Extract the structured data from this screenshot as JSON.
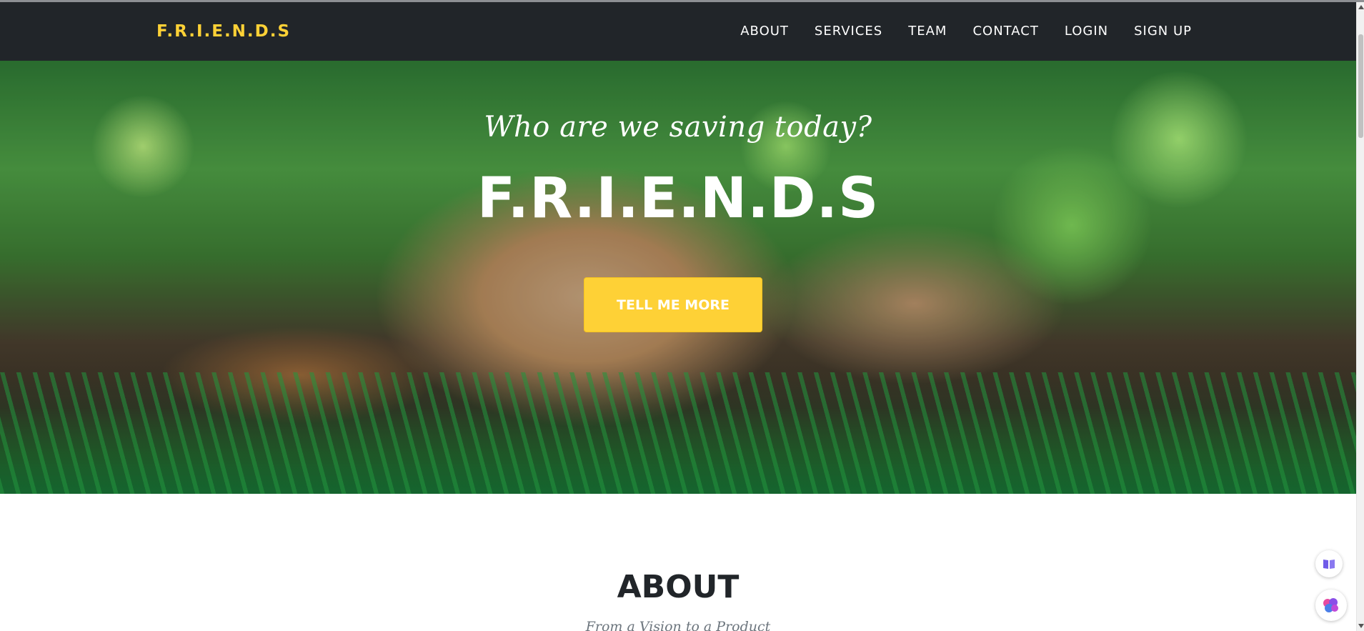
{
  "navbar": {
    "brand": "F.R.I.E.N.D.S",
    "links": [
      "ABOUT",
      "SERVICES",
      "TEAM",
      "CONTACT",
      "LOGIN",
      "SIGN UP"
    ]
  },
  "hero": {
    "subtitle": "Who are we saving today?",
    "title": "F.R.I.E.N.D.S",
    "button_label": "TELL ME MORE"
  },
  "about": {
    "heading": "ABOUT",
    "subheading": "From a Vision to a Product"
  },
  "widgets": {
    "book_icon": "book-icon",
    "brain_icon": "brain-icon"
  },
  "colors": {
    "navbar_bg": "#212529",
    "brand_accent": "#fed136",
    "text_dark": "#212529"
  }
}
